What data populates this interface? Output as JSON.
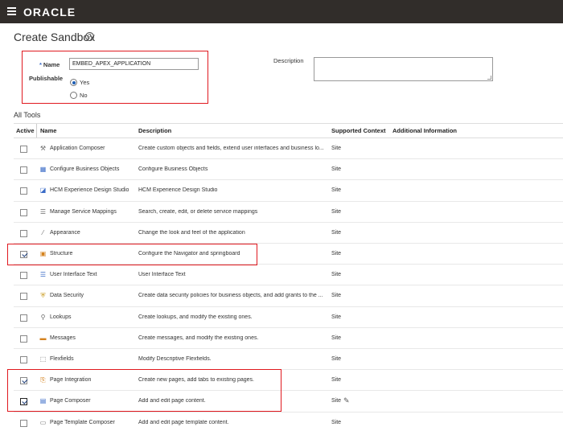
{
  "brand": {
    "logo": "ORACLE"
  },
  "page": {
    "title": "Create Sandbox"
  },
  "form": {
    "name_label": "Name",
    "name_value": "EMBED_APEX_APPLICATION",
    "publishable_label": "Publishable",
    "publishable_options": [
      {
        "label": "Yes",
        "selected": true
      },
      {
        "label": "No",
        "selected": false
      }
    ],
    "description_label": "Description",
    "description_value": ""
  },
  "tools": {
    "section_title": "All Tools",
    "columns": {
      "active": "Active",
      "name": "Name",
      "description": "Description",
      "context": "Supported Context",
      "info": "Additional Information"
    },
    "rows": [
      {
        "active": false,
        "icon": "wrench-icon",
        "name": "Application Composer",
        "description": "Create custom objects and fields, extend user interfaces and business lo...",
        "context": "Site"
      },
      {
        "active": false,
        "icon": "objects-icon",
        "name": "Configure Business Objects",
        "description": "Configure Business Objects",
        "context": "Site"
      },
      {
        "active": false,
        "icon": "design-studio-icon",
        "name": "HCM Experience Design Studio",
        "description": "HCM Experience Design Studio",
        "context": "Site"
      },
      {
        "active": false,
        "icon": "list-icon",
        "name": "Manage Service Mappings",
        "description": "Search, create, edit, or delete service mappings",
        "context": "Site"
      },
      {
        "active": false,
        "icon": "brush-icon",
        "name": "Appearance",
        "description": "Change the look and feel of the application",
        "context": "Site"
      },
      {
        "active": true,
        "icon": "grid-icon",
        "name": "Structure",
        "description": "Configure the Navigator and springboard",
        "context": "Site"
      },
      {
        "active": false,
        "icon": "text-icon",
        "name": "User Interface Text",
        "description": "User Interface Text",
        "context": "Site"
      },
      {
        "active": false,
        "icon": "shield-icon",
        "name": "Data Security",
        "description": "Create data security policies for business objects, and add grants to the ...",
        "context": "Site"
      },
      {
        "active": false,
        "icon": "search-icon",
        "name": "Lookups",
        "description": "Create lookups, and modify the existing ones.",
        "context": "Site"
      },
      {
        "active": false,
        "icon": "message-icon",
        "name": "Messages",
        "description": "Create messages, and modify the existing ones.",
        "context": "Site"
      },
      {
        "active": false,
        "icon": "flexfield-icon",
        "name": "Flexfields",
        "description": "Modify Descriptive Flexfields.",
        "context": "Site"
      },
      {
        "active": true,
        "icon": "page-add-icon",
        "name": "Page Integration",
        "description": "Create new pages, add tabs to existing pages.",
        "context": "Site"
      },
      {
        "active": true,
        "icon": "page-composer-icon",
        "name": "Page Composer",
        "description": "Add and edit page content.",
        "context": "Site",
        "editable": true
      },
      {
        "active": false,
        "icon": "page-template-icon",
        "name": "Page Template Composer",
        "description": "Add and edit page template content.",
        "context": "Site"
      }
    ]
  },
  "colors": {
    "topbar": "#312d2a",
    "highlight": "#e0191f",
    "accent": "#1e5eb4"
  }
}
